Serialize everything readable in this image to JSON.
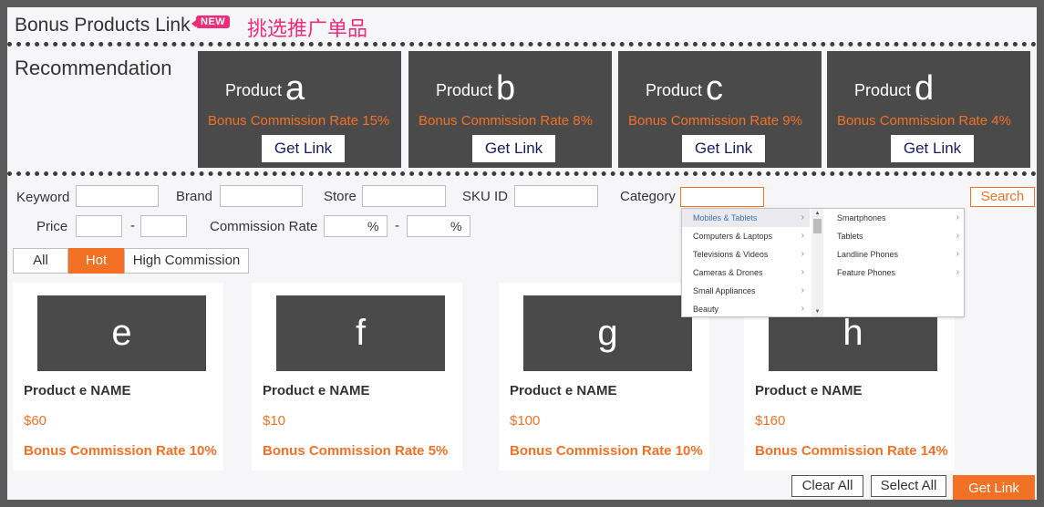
{
  "header": {
    "title": "Bonus Products Link",
    "badge": "NEW",
    "subtitle": "挑选推广单品"
  },
  "recommendation": {
    "label": "Recommendation",
    "items": [
      {
        "product_word": "Product",
        "letter": "a",
        "rate": "Bonus Commission Rate 15%",
        "button": "Get Link"
      },
      {
        "product_word": "Product",
        "letter": "b",
        "rate": "Bonus Commission Rate 8%",
        "button": "Get Link"
      },
      {
        "product_word": "Product",
        "letter": "c",
        "rate": "Bonus Commission Rate 9%",
        "button": "Get Link"
      },
      {
        "product_word": "Product",
        "letter": "d",
        "rate": "Bonus Commission Rate 4%",
        "button": "Get Link"
      }
    ]
  },
  "filters": {
    "keyword_label": "Keyword",
    "keyword_value": "",
    "brand_label": "Brand",
    "brand_value": "",
    "store_label": "Store",
    "store_value": "",
    "sku_label": "SKU ID",
    "sku_value": "",
    "category_label": "Category",
    "category_value": "",
    "price_label": "Price",
    "price_min": "",
    "price_max": "",
    "range_sep": "-",
    "commission_label": "Commission Rate",
    "commission_min": "",
    "commission_max": "",
    "percent": "%",
    "search_button": "Search"
  },
  "category_dropdown": {
    "categories": [
      {
        "label": "Mobiles & Tablets",
        "selected": true
      },
      {
        "label": "Computers & Laptops",
        "selected": false
      },
      {
        "label": "Televisions & Videos",
        "selected": false
      },
      {
        "label": "Cameras & Drones",
        "selected": false
      },
      {
        "label": "Small Appliances",
        "selected": false
      },
      {
        "label": "Beauty",
        "selected": false
      }
    ],
    "subcategories": [
      "Smartphones",
      "Tablets",
      "Landline Phones",
      "Feature Phones"
    ],
    "chevron": "›",
    "scroll_up": "▲",
    "scroll_down": "▼"
  },
  "tabs": [
    {
      "label": "All",
      "active": false
    },
    {
      "label": "Hot",
      "active": true
    },
    {
      "label": "High Commission",
      "active": false
    }
  ],
  "products": [
    {
      "thumb": "e",
      "name": "Product e NAME",
      "price": "$60",
      "rate": "Bonus Commission Rate 10%"
    },
    {
      "thumb": "f",
      "name": "Product e NAME",
      "price": "$10",
      "rate": "Bonus Commission Rate 5%"
    },
    {
      "thumb": "g",
      "name": "Product e NAME",
      "price": "$100",
      "rate": "Bonus Commission Rate 10%"
    },
    {
      "thumb": "h",
      "name": "Product e NAME",
      "price": "$160",
      "rate": "Bonus Commission Rate 14%"
    }
  ],
  "actions": {
    "clear_all": "Clear All",
    "select_all": "Select All",
    "get_link": "Get Link"
  },
  "colors": {
    "accent": "#f37125",
    "brand_pink": "#ee2c78",
    "card_dark": "#4a4a4a",
    "dropdown_selected": "#3c73b5"
  }
}
